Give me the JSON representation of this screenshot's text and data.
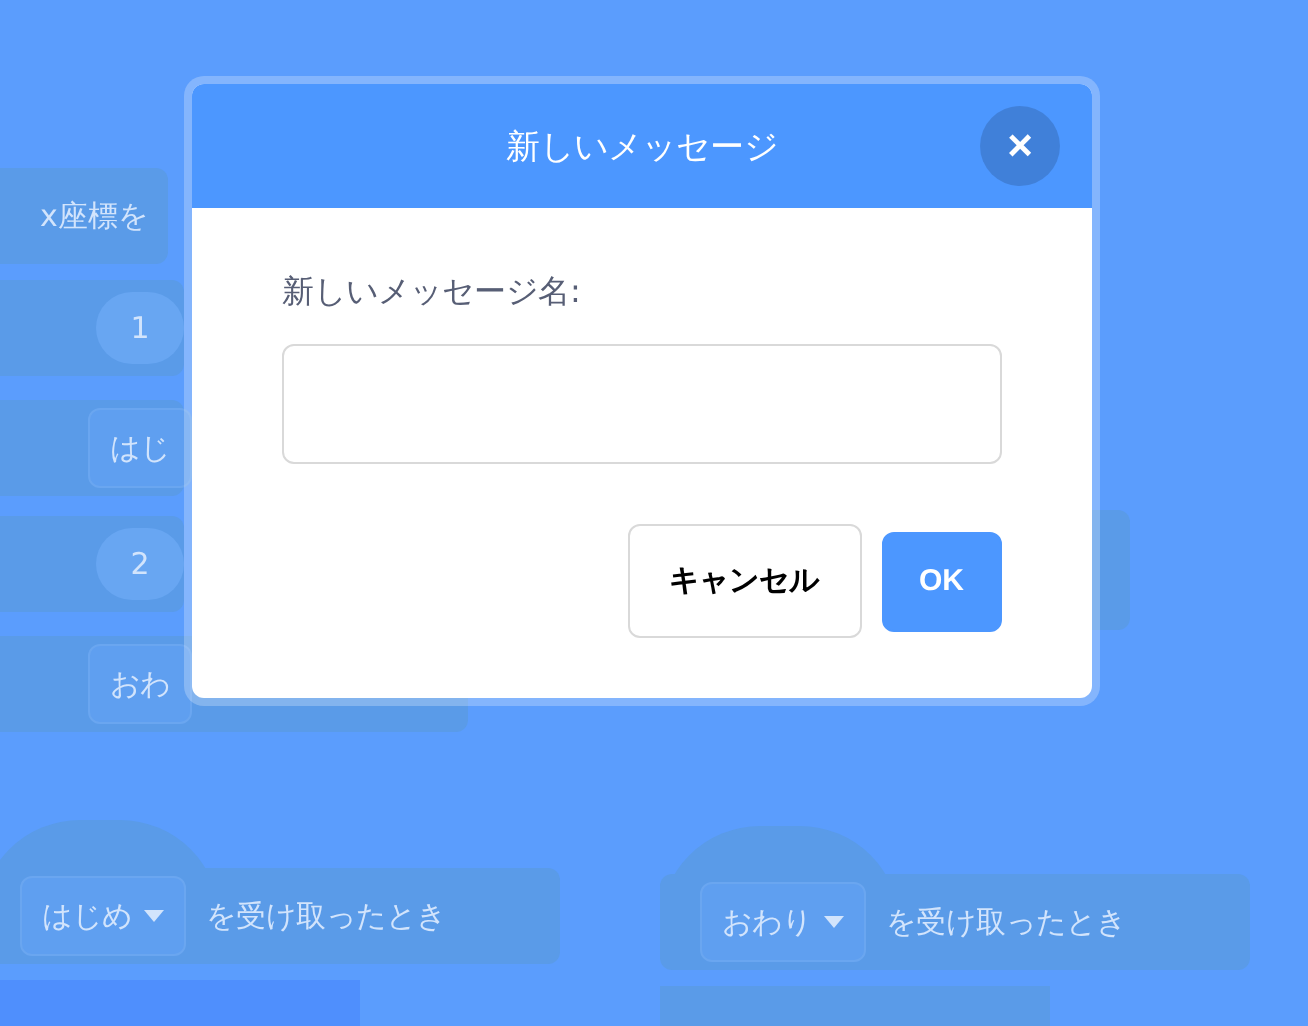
{
  "workspace": {
    "blocks": [
      {
        "kind": "text",
        "label": "x座標を"
      },
      {
        "kind": "number",
        "label": "1"
      },
      {
        "kind": "menu",
        "label": "はじ"
      },
      {
        "kind": "number",
        "label": "2"
      },
      {
        "kind": "menu",
        "label": "おわ"
      },
      {
        "kind": "hat",
        "label": "はじめ",
        "trailing": "を受け取ったとき"
      },
      {
        "kind": "hat",
        "label": "おわり",
        "trailing": "を受け取ったとき"
      }
    ]
  },
  "dialog": {
    "title": "新しいメッセージ",
    "close": "×",
    "label": "新しいメッセージ名:",
    "buttons": [
      {
        "kind": "secondary",
        "label": "キャンセル"
      },
      {
        "kind": "primary",
        "label": "OK"
      }
    ]
  }
}
